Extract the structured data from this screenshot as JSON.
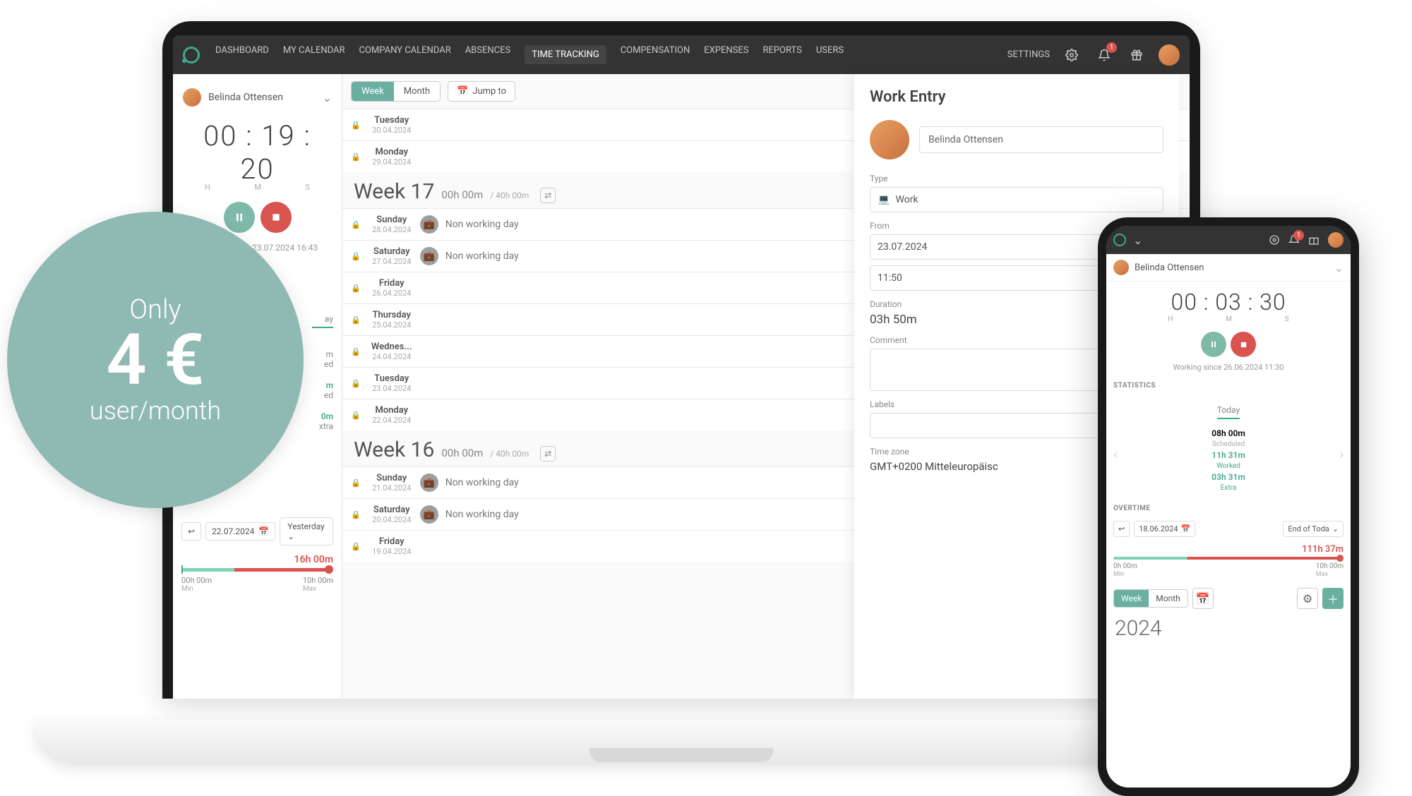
{
  "nav": {
    "items": [
      "DASHBOARD",
      "MY CALENDAR",
      "COMPANY CALENDAR",
      "ABSENCES",
      "TIME TRACKING",
      "COMPENSATION",
      "EXPENSES",
      "REPORTS",
      "USERS"
    ],
    "active": "TIME TRACKING",
    "settings": "SETTINGS",
    "notif_count": "1"
  },
  "user_selector": {
    "name": "Belinda Ottensen"
  },
  "timer": {
    "h": "00",
    "m": "19",
    "s": "20",
    "H": "H",
    "M": "M",
    "S": "S"
  },
  "since": "Working since 23.07.2024 16:43",
  "side_stats": {
    "day": "ay",
    "m_label": "m",
    "ed_label": "ed",
    "m_label2": "m",
    "ed_label2": "ed",
    "extra_val": "0m",
    "extra_label": "xtra"
  },
  "date_nav": {
    "date": "22.07.2024",
    "preset": "Yesterday"
  },
  "overtime": {
    "value": "16h 00m",
    "min": "00h 00m",
    "min_label": "Min",
    "max": "10h 00m",
    "max_label": "Max"
  },
  "toolbar": {
    "week": "Week",
    "month": "Month",
    "jump": "Jump to"
  },
  "week17": {
    "title": "Week 17",
    "total": "00h 00m",
    "planned": "/ 40h 00m"
  },
  "week16": {
    "title": "Week 16",
    "total": "00h 00m",
    "planned": "/ 40h 00m"
  },
  "days": {
    "tue": {
      "name": "Tuesday",
      "date": "30.04.2024"
    },
    "mon": {
      "name": "Monday",
      "date": "29.04.2024"
    },
    "sun": {
      "name": "Sunday",
      "date": "28.04.2024"
    },
    "sat": {
      "name": "Saturday",
      "date": "27.04.2024"
    },
    "fri": {
      "name": "Friday",
      "date": "26.04.2024"
    },
    "thu": {
      "name": "Thursday",
      "date": "25.04.2024"
    },
    "wed": {
      "name": "Wednes...",
      "date": "24.04.2024"
    },
    "tue2": {
      "name": "Tuesday",
      "date": "23.04.2024"
    },
    "mon2": {
      "name": "Monday",
      "date": "22.04.2024"
    },
    "sun2": {
      "name": "Sunday",
      "date": "21.04.2024"
    },
    "sat2": {
      "name": "Saturday",
      "date": "20.04.2024"
    },
    "fri2": {
      "name": "Friday",
      "date": "19.04.2024"
    }
  },
  "nwd": "Non working day",
  "work_entry": {
    "title": "Work Entry",
    "user": "Belinda Ottensen",
    "type_label": "Type",
    "type_value": "Work",
    "from_label": "From",
    "from_date": "23.07.2024",
    "from_time": "11:50",
    "duration_label": "Duration",
    "duration": "03h 50m",
    "comment_label": "Comment",
    "labels_label": "Labels",
    "tz_label": "Time zone",
    "tz": "GMT+0200 Mitteleuropäisc"
  },
  "phone": {
    "user": "Belinda Ottensen",
    "timer": {
      "h": "00",
      "m": "03",
      "s": "30",
      "H": "H",
      "M": "M",
      "S": "S"
    },
    "since": "Working since 26.06.2024 11:30",
    "stats_label": "STATISTICS",
    "today": "Today",
    "sched_val": "08h 00m",
    "sched_label": "Scheduled",
    "worked_val": "11h 31m",
    "worked_label": "Worked",
    "extra_val": "03h 31m",
    "extra_label": "Extra",
    "ot_label": "OVERTIME",
    "ot_date": "18.06.2024",
    "ot_preset": "End of Toda",
    "ot_val": "111h 37m",
    "ot_min": "0h 00m",
    "ot_min_label": "Min",
    "ot_max": "10h 00m",
    "ot_max_label": "Max",
    "week": "Week",
    "month": "Month",
    "year": "2024",
    "notif_count": "1"
  },
  "pricing": {
    "only": "Only",
    "price": "4 €",
    "per": "user/month"
  }
}
